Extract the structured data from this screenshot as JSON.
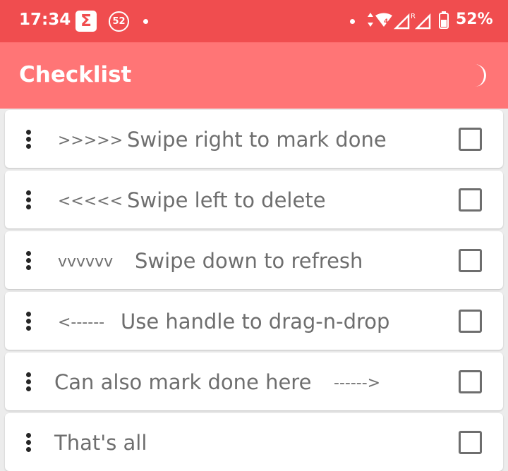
{
  "status_bar": {
    "time": "17:34",
    "sigma": "Σ",
    "badge": "52",
    "battery_pct": "52%",
    "bg_color": "#f04d4f"
  },
  "app_bar": {
    "title": "Checklist",
    "theme_icon": "moon-icon",
    "bg_color": "#ff7576"
  },
  "items": [
    {
      "arrows": ">>>>>",
      "label": "Swipe right to mark done",
      "checked": false
    },
    {
      "arrows": "<<<<<",
      "label": "Swipe left to delete",
      "checked": false
    },
    {
      "arrows": "vvvvvv",
      "label": "Swipe down to refresh",
      "checked": false
    },
    {
      "arrows": "<------",
      "label": "Use handle to drag-n-drop",
      "checked": false
    },
    {
      "label": "Can also mark done here",
      "arrows": "------>",
      "checked": false
    },
    {
      "label": "That's all",
      "checked": false
    }
  ]
}
